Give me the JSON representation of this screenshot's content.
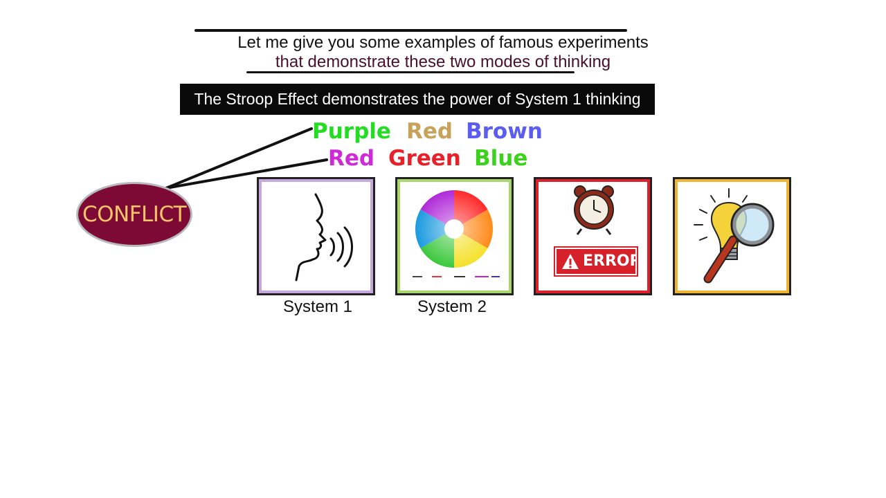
{
  "header": {
    "line1": "Let me give you some examples of famous experiments",
    "line2": "that demonstrate these two modes of thinking"
  },
  "banner": {
    "text": "The Stroop Effect demonstrates the power of System 1 thinking"
  },
  "stroop": {
    "row1": [
      {
        "word": "Purple",
        "color": "#22dd22"
      },
      {
        "word": "Red",
        "color": "#c8a25a"
      },
      {
        "word": "Brown",
        "color": "#5a5df0"
      }
    ],
    "row2": [
      {
        "word": "Red",
        "color": "#d02ad8"
      },
      {
        "word": "Green",
        "color": "#e8202a"
      },
      {
        "word": "Blue",
        "color": "#3ad21a"
      }
    ]
  },
  "conflict": {
    "label": "CONFLICT",
    "fill": "#7c0a35",
    "text_color": "#f5c46a"
  },
  "cards": [
    {
      "icon": "speaking-head-icon",
      "caption": "System 1",
      "border_color": "#c7a8dd"
    },
    {
      "icon": "color-wheel-icon",
      "caption": "System 2",
      "border_color": "#a8d86b"
    },
    {
      "icon": "alarm-clock-error-icon",
      "caption": "",
      "badge": "ERROR",
      "border_color": "#e0202a"
    },
    {
      "icon": "lightbulb-magnifier-icon",
      "caption": "",
      "border_color": "#f0b530"
    }
  ]
}
